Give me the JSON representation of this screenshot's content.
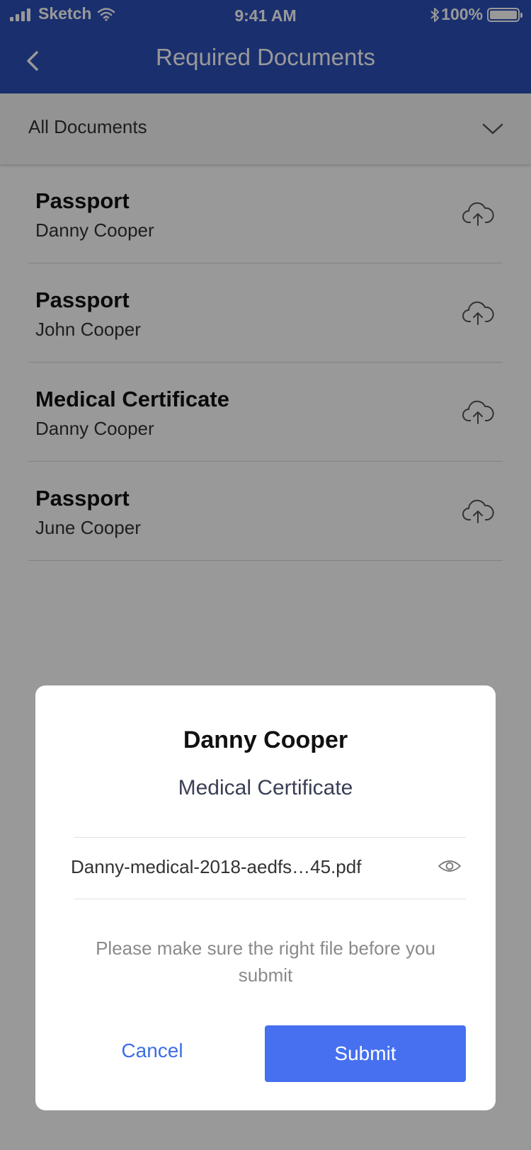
{
  "status_bar": {
    "carrier": "Sketch",
    "time": "9:41 AM",
    "battery": "100%",
    "icons": [
      "signal-icon",
      "wifi-icon",
      "bluetooth-icon",
      "battery-icon"
    ]
  },
  "nav": {
    "title": "Required Documents",
    "back_icon": "back-chevron-icon"
  },
  "filter": {
    "label": "All Documents",
    "icon": "chevron-down-icon"
  },
  "documents": [
    {
      "title": "Passport",
      "person": "Danny Cooper"
    },
    {
      "title": "Passport",
      "person": "John Cooper"
    },
    {
      "title": "Medical Certificate",
      "person": "Danny Cooper"
    },
    {
      "title": "Passport",
      "person": "June Cooper"
    }
  ],
  "modal": {
    "name": "Danny Cooper",
    "document": "Medical Certificate",
    "file_name": "Danny-medical-2018-aedfs…45.pdf",
    "note": "Please make sure the right file before you submit",
    "cancel_label": "Cancel",
    "submit_label": "Submit"
  },
  "colors": {
    "header": "#2C4FB7",
    "accent": "#4670F0",
    "overlay": "rgba(0,0,0,0.4)"
  }
}
